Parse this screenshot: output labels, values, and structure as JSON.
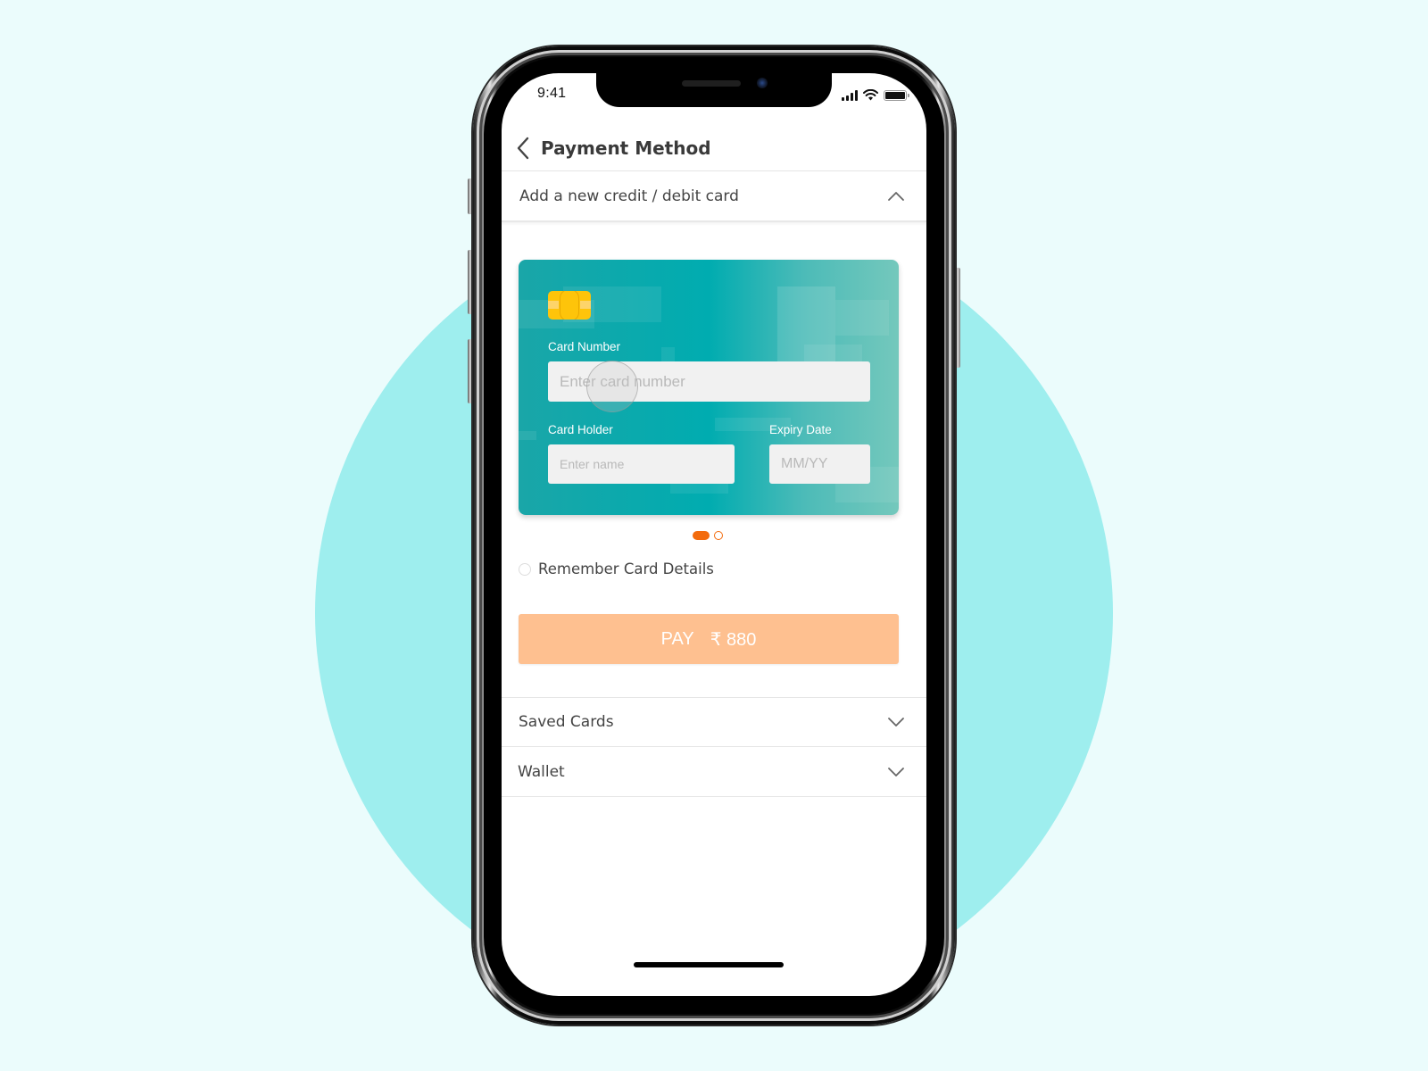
{
  "status_bar": {
    "time": "9:41",
    "icons": [
      "signal-icon",
      "wifi-icon",
      "battery-icon"
    ]
  },
  "header": {
    "back_icon": "chevron-left-icon",
    "title": "Payment Method"
  },
  "new_card_section": {
    "label": "Add a new credit / debit card",
    "expanded": true,
    "toggle_icon": "chevron-up-icon",
    "card": {
      "chip_icon": "card-chip-icon",
      "card_number": {
        "label": "Card Number",
        "placeholder": "Enter card number",
        "value": ""
      },
      "card_holder": {
        "label": "Card Holder",
        "placeholder": "Enter name",
        "value": ""
      },
      "expiry": {
        "label": "Expiry Date",
        "placeholder": "MM/YY",
        "value": ""
      }
    },
    "pager": {
      "total": 2,
      "active_index": 0
    },
    "remember": {
      "label": "Remember Card Details",
      "checked": false
    },
    "pay_button": {
      "label": "PAY",
      "currency_symbol": "₹",
      "amount": "880"
    }
  },
  "other_sections": [
    {
      "label": "Saved Cards",
      "icon": "chevron-down-icon",
      "expanded": false
    },
    {
      "label": "Wallet",
      "icon": "chevron-down-icon",
      "expanded": false
    }
  ],
  "colors": {
    "background": "#ebfcfc",
    "circle": "#9eeeee",
    "card_teal": "#00acb0",
    "chip": "#fec40a",
    "accent_orange": "#f36b0d",
    "pay_button": "#fec090"
  }
}
